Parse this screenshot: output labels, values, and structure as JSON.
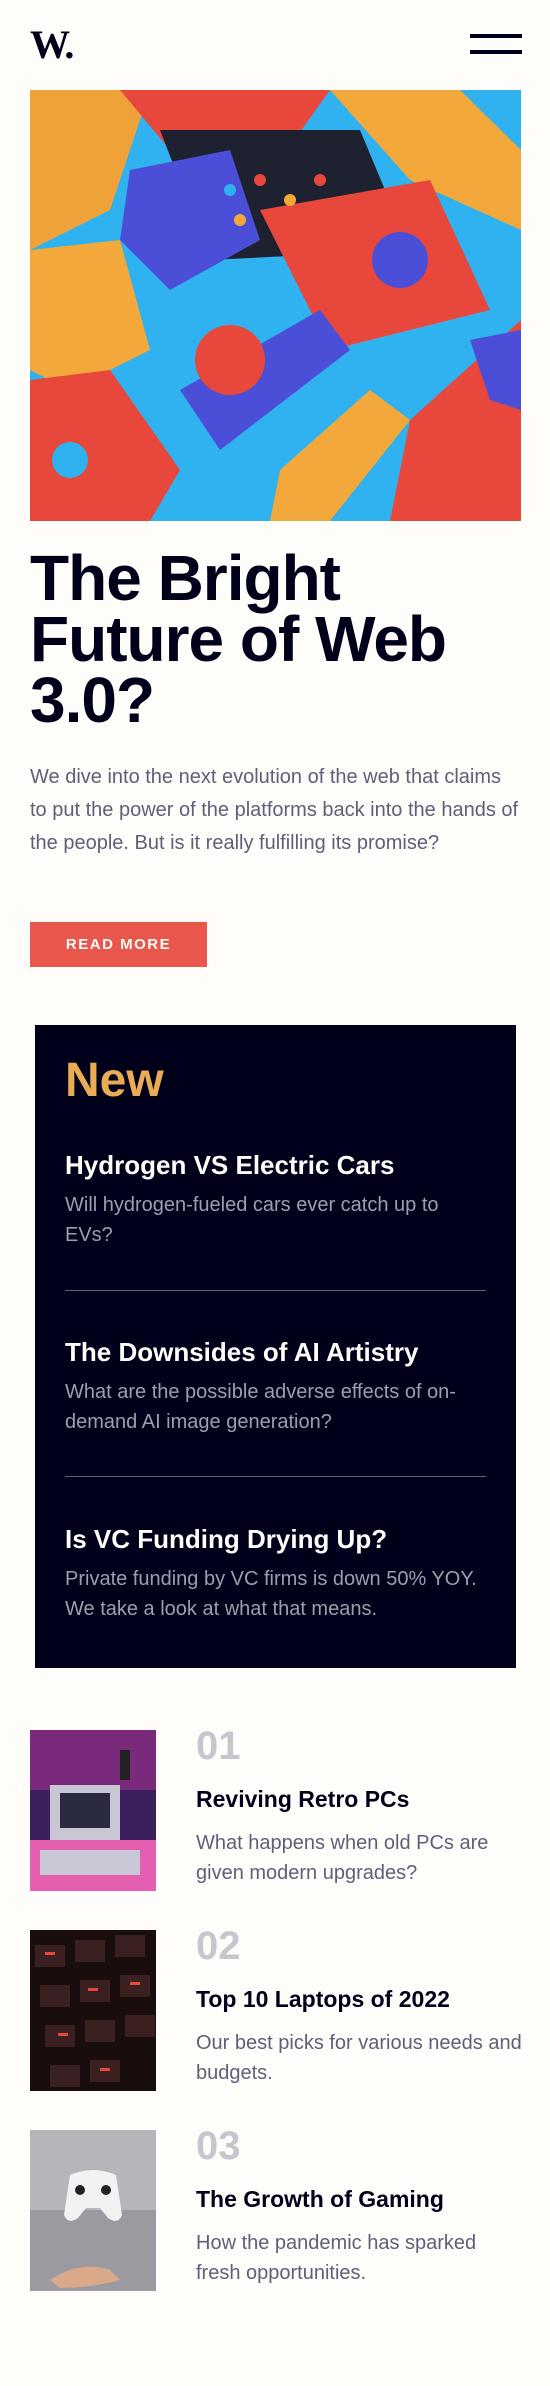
{
  "header": {
    "logo": "W.",
    "menu_icon": "hamburger-menu-icon"
  },
  "hero": {
    "image_icon": "abstract-3d-blocks-illustration",
    "title": "The Bright Future of Web 3.0?",
    "description": "We dive into the next evolution of the web that claims to put the power of the platforms back into the hands of the people. But is it really fulfilling its promise?",
    "button_label": "READ MORE"
  },
  "new_section": {
    "title": "New",
    "items": [
      {
        "title": "Hydrogen VS Electric Cars",
        "description": "Will hydrogen-fueled cars ever catch up to EVs?"
      },
      {
        "title": "The Downsides of AI Artistry",
        "description": "What are the possible adverse effects of on-demand AI image generation?"
      },
      {
        "title": "Is VC Funding Drying Up?",
        "description": "Private funding by VC firms is down 50% YOY. We take a look at what that means."
      }
    ]
  },
  "articles": [
    {
      "number": "01",
      "title": "Reviving Retro PCs",
      "description": "What happens when old PCs are given modern upgrades?",
      "image_icon": "retro-pc-thumbnail"
    },
    {
      "number": "02",
      "title": "Top 10 Laptops of 2022",
      "description": "Our best picks for various needs and budgets.",
      "image_icon": "laptop-keyboard-thumbnail"
    },
    {
      "number": "03",
      "title": "The Growth of Gaming",
      "description": "How the pandemic has sparked fresh opportunities.",
      "image_icon": "game-controller-thumbnail"
    }
  ],
  "colors": {
    "background": "#fffdfa",
    "dark_navy": "#00001a",
    "soft_red": "#e9564b",
    "soft_orange": "#e9ab53",
    "grayish_blue": "#5e607a",
    "light_gray": "#c5c6ce"
  }
}
